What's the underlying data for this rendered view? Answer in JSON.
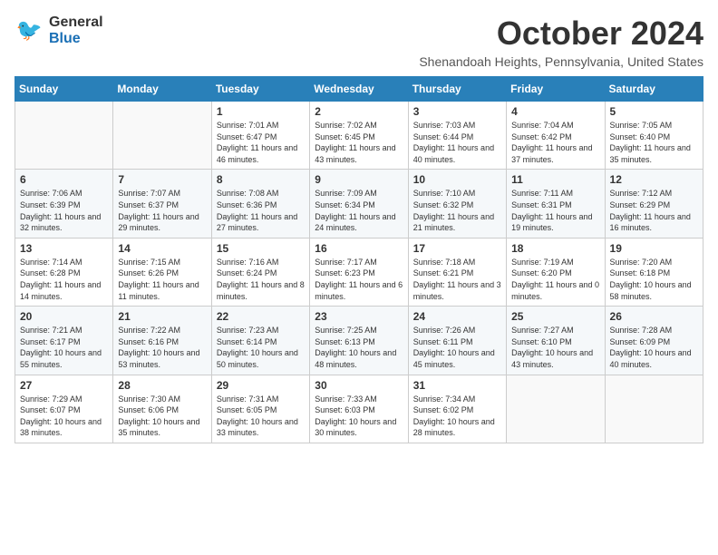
{
  "header": {
    "title": "October 2024",
    "location": "Shenandoah Heights, Pennsylvania, United States",
    "logo_general": "General",
    "logo_blue": "Blue"
  },
  "weekdays": [
    "Sunday",
    "Monday",
    "Tuesday",
    "Wednesday",
    "Thursday",
    "Friday",
    "Saturday"
  ],
  "weeks": [
    [
      {
        "day": "",
        "info": ""
      },
      {
        "day": "",
        "info": ""
      },
      {
        "day": "1",
        "info": "Sunrise: 7:01 AM\nSunset: 6:47 PM\nDaylight: 11 hours and 46 minutes."
      },
      {
        "day": "2",
        "info": "Sunrise: 7:02 AM\nSunset: 6:45 PM\nDaylight: 11 hours and 43 minutes."
      },
      {
        "day": "3",
        "info": "Sunrise: 7:03 AM\nSunset: 6:44 PM\nDaylight: 11 hours and 40 minutes."
      },
      {
        "day": "4",
        "info": "Sunrise: 7:04 AM\nSunset: 6:42 PM\nDaylight: 11 hours and 37 minutes."
      },
      {
        "day": "5",
        "info": "Sunrise: 7:05 AM\nSunset: 6:40 PM\nDaylight: 11 hours and 35 minutes."
      }
    ],
    [
      {
        "day": "6",
        "info": "Sunrise: 7:06 AM\nSunset: 6:39 PM\nDaylight: 11 hours and 32 minutes."
      },
      {
        "day": "7",
        "info": "Sunrise: 7:07 AM\nSunset: 6:37 PM\nDaylight: 11 hours and 29 minutes."
      },
      {
        "day": "8",
        "info": "Sunrise: 7:08 AM\nSunset: 6:36 PM\nDaylight: 11 hours and 27 minutes."
      },
      {
        "day": "9",
        "info": "Sunrise: 7:09 AM\nSunset: 6:34 PM\nDaylight: 11 hours and 24 minutes."
      },
      {
        "day": "10",
        "info": "Sunrise: 7:10 AM\nSunset: 6:32 PM\nDaylight: 11 hours and 21 minutes."
      },
      {
        "day": "11",
        "info": "Sunrise: 7:11 AM\nSunset: 6:31 PM\nDaylight: 11 hours and 19 minutes."
      },
      {
        "day": "12",
        "info": "Sunrise: 7:12 AM\nSunset: 6:29 PM\nDaylight: 11 hours and 16 minutes."
      }
    ],
    [
      {
        "day": "13",
        "info": "Sunrise: 7:14 AM\nSunset: 6:28 PM\nDaylight: 11 hours and 14 minutes."
      },
      {
        "day": "14",
        "info": "Sunrise: 7:15 AM\nSunset: 6:26 PM\nDaylight: 11 hours and 11 minutes."
      },
      {
        "day": "15",
        "info": "Sunrise: 7:16 AM\nSunset: 6:24 PM\nDaylight: 11 hours and 8 minutes."
      },
      {
        "day": "16",
        "info": "Sunrise: 7:17 AM\nSunset: 6:23 PM\nDaylight: 11 hours and 6 minutes."
      },
      {
        "day": "17",
        "info": "Sunrise: 7:18 AM\nSunset: 6:21 PM\nDaylight: 11 hours and 3 minutes."
      },
      {
        "day": "18",
        "info": "Sunrise: 7:19 AM\nSunset: 6:20 PM\nDaylight: 11 hours and 0 minutes."
      },
      {
        "day": "19",
        "info": "Sunrise: 7:20 AM\nSunset: 6:18 PM\nDaylight: 10 hours and 58 minutes."
      }
    ],
    [
      {
        "day": "20",
        "info": "Sunrise: 7:21 AM\nSunset: 6:17 PM\nDaylight: 10 hours and 55 minutes."
      },
      {
        "day": "21",
        "info": "Sunrise: 7:22 AM\nSunset: 6:16 PM\nDaylight: 10 hours and 53 minutes."
      },
      {
        "day": "22",
        "info": "Sunrise: 7:23 AM\nSunset: 6:14 PM\nDaylight: 10 hours and 50 minutes."
      },
      {
        "day": "23",
        "info": "Sunrise: 7:25 AM\nSunset: 6:13 PM\nDaylight: 10 hours and 48 minutes."
      },
      {
        "day": "24",
        "info": "Sunrise: 7:26 AM\nSunset: 6:11 PM\nDaylight: 10 hours and 45 minutes."
      },
      {
        "day": "25",
        "info": "Sunrise: 7:27 AM\nSunset: 6:10 PM\nDaylight: 10 hours and 43 minutes."
      },
      {
        "day": "26",
        "info": "Sunrise: 7:28 AM\nSunset: 6:09 PM\nDaylight: 10 hours and 40 minutes."
      }
    ],
    [
      {
        "day": "27",
        "info": "Sunrise: 7:29 AM\nSunset: 6:07 PM\nDaylight: 10 hours and 38 minutes."
      },
      {
        "day": "28",
        "info": "Sunrise: 7:30 AM\nSunset: 6:06 PM\nDaylight: 10 hours and 35 minutes."
      },
      {
        "day": "29",
        "info": "Sunrise: 7:31 AM\nSunset: 6:05 PM\nDaylight: 10 hours and 33 minutes."
      },
      {
        "day": "30",
        "info": "Sunrise: 7:33 AM\nSunset: 6:03 PM\nDaylight: 10 hours and 30 minutes."
      },
      {
        "day": "31",
        "info": "Sunrise: 7:34 AM\nSunset: 6:02 PM\nDaylight: 10 hours and 28 minutes."
      },
      {
        "day": "",
        "info": ""
      },
      {
        "day": "",
        "info": ""
      }
    ]
  ]
}
